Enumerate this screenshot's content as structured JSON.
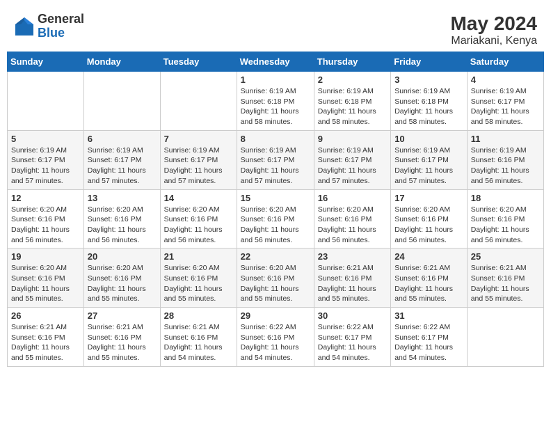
{
  "header": {
    "logo_general": "General",
    "logo_blue": "Blue",
    "month_year": "May 2024",
    "location": "Mariakani, Kenya"
  },
  "weekdays": [
    "Sunday",
    "Monday",
    "Tuesday",
    "Wednesday",
    "Thursday",
    "Friday",
    "Saturday"
  ],
  "weeks": [
    [
      {
        "day": "",
        "info": ""
      },
      {
        "day": "",
        "info": ""
      },
      {
        "day": "",
        "info": ""
      },
      {
        "day": "1",
        "info": "Sunrise: 6:19 AM\nSunset: 6:18 PM\nDaylight: 11 hours and 58 minutes."
      },
      {
        "day": "2",
        "info": "Sunrise: 6:19 AM\nSunset: 6:18 PM\nDaylight: 11 hours and 58 minutes."
      },
      {
        "day": "3",
        "info": "Sunrise: 6:19 AM\nSunset: 6:18 PM\nDaylight: 11 hours and 58 minutes."
      },
      {
        "day": "4",
        "info": "Sunrise: 6:19 AM\nSunset: 6:17 PM\nDaylight: 11 hours and 58 minutes."
      }
    ],
    [
      {
        "day": "5",
        "info": "Sunrise: 6:19 AM\nSunset: 6:17 PM\nDaylight: 11 hours and 57 minutes."
      },
      {
        "day": "6",
        "info": "Sunrise: 6:19 AM\nSunset: 6:17 PM\nDaylight: 11 hours and 57 minutes."
      },
      {
        "day": "7",
        "info": "Sunrise: 6:19 AM\nSunset: 6:17 PM\nDaylight: 11 hours and 57 minutes."
      },
      {
        "day": "8",
        "info": "Sunrise: 6:19 AM\nSunset: 6:17 PM\nDaylight: 11 hours and 57 minutes."
      },
      {
        "day": "9",
        "info": "Sunrise: 6:19 AM\nSunset: 6:17 PM\nDaylight: 11 hours and 57 minutes."
      },
      {
        "day": "10",
        "info": "Sunrise: 6:19 AM\nSunset: 6:17 PM\nDaylight: 11 hours and 57 minutes."
      },
      {
        "day": "11",
        "info": "Sunrise: 6:19 AM\nSunset: 6:16 PM\nDaylight: 11 hours and 56 minutes."
      }
    ],
    [
      {
        "day": "12",
        "info": "Sunrise: 6:20 AM\nSunset: 6:16 PM\nDaylight: 11 hours and 56 minutes."
      },
      {
        "day": "13",
        "info": "Sunrise: 6:20 AM\nSunset: 6:16 PM\nDaylight: 11 hours and 56 minutes."
      },
      {
        "day": "14",
        "info": "Sunrise: 6:20 AM\nSunset: 6:16 PM\nDaylight: 11 hours and 56 minutes."
      },
      {
        "day": "15",
        "info": "Sunrise: 6:20 AM\nSunset: 6:16 PM\nDaylight: 11 hours and 56 minutes."
      },
      {
        "day": "16",
        "info": "Sunrise: 6:20 AM\nSunset: 6:16 PM\nDaylight: 11 hours and 56 minutes."
      },
      {
        "day": "17",
        "info": "Sunrise: 6:20 AM\nSunset: 6:16 PM\nDaylight: 11 hours and 56 minutes."
      },
      {
        "day": "18",
        "info": "Sunrise: 6:20 AM\nSunset: 6:16 PM\nDaylight: 11 hours and 56 minutes."
      }
    ],
    [
      {
        "day": "19",
        "info": "Sunrise: 6:20 AM\nSunset: 6:16 PM\nDaylight: 11 hours and 55 minutes."
      },
      {
        "day": "20",
        "info": "Sunrise: 6:20 AM\nSunset: 6:16 PM\nDaylight: 11 hours and 55 minutes."
      },
      {
        "day": "21",
        "info": "Sunrise: 6:20 AM\nSunset: 6:16 PM\nDaylight: 11 hours and 55 minutes."
      },
      {
        "day": "22",
        "info": "Sunrise: 6:20 AM\nSunset: 6:16 PM\nDaylight: 11 hours and 55 minutes."
      },
      {
        "day": "23",
        "info": "Sunrise: 6:21 AM\nSunset: 6:16 PM\nDaylight: 11 hours and 55 minutes."
      },
      {
        "day": "24",
        "info": "Sunrise: 6:21 AM\nSunset: 6:16 PM\nDaylight: 11 hours and 55 minutes."
      },
      {
        "day": "25",
        "info": "Sunrise: 6:21 AM\nSunset: 6:16 PM\nDaylight: 11 hours and 55 minutes."
      }
    ],
    [
      {
        "day": "26",
        "info": "Sunrise: 6:21 AM\nSunset: 6:16 PM\nDaylight: 11 hours and 55 minutes."
      },
      {
        "day": "27",
        "info": "Sunrise: 6:21 AM\nSunset: 6:16 PM\nDaylight: 11 hours and 55 minutes."
      },
      {
        "day": "28",
        "info": "Sunrise: 6:21 AM\nSunset: 6:16 PM\nDaylight: 11 hours and 54 minutes."
      },
      {
        "day": "29",
        "info": "Sunrise: 6:22 AM\nSunset: 6:16 PM\nDaylight: 11 hours and 54 minutes."
      },
      {
        "day": "30",
        "info": "Sunrise: 6:22 AM\nSunset: 6:17 PM\nDaylight: 11 hours and 54 minutes."
      },
      {
        "day": "31",
        "info": "Sunrise: 6:22 AM\nSunset: 6:17 PM\nDaylight: 11 hours and 54 minutes."
      },
      {
        "day": "",
        "info": ""
      }
    ]
  ]
}
